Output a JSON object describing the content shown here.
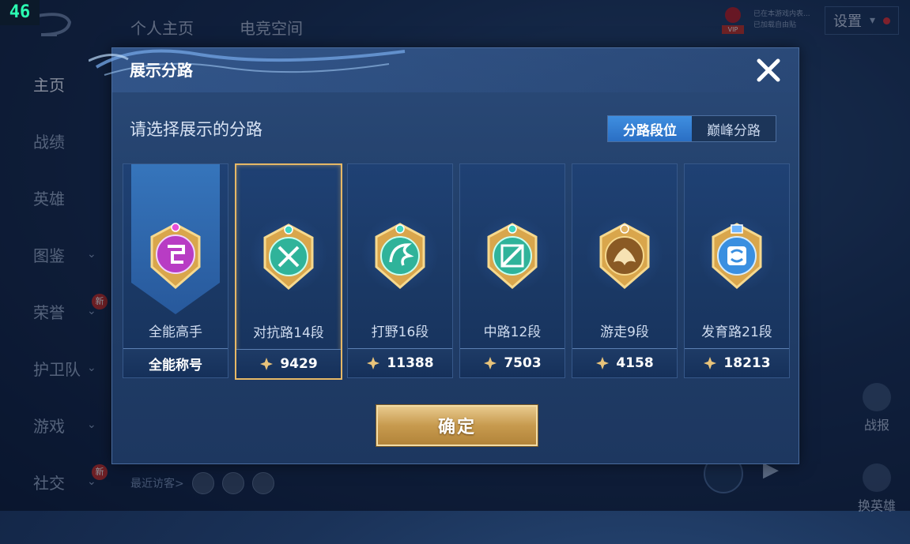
{
  "fps_counter": "46",
  "top_tabs": [
    "个人主页",
    "电竞空间"
  ],
  "top_right": {
    "vip_label": "VIP",
    "notice_line1": "已在本游戏内表...",
    "notice_line2": "已加载自由贴",
    "settings_label": "设置"
  },
  "sidebar": {
    "items": [
      {
        "label": "主页"
      },
      {
        "label": "战绩"
      },
      {
        "label": "英雄"
      },
      {
        "label": "图鉴"
      },
      {
        "label": "荣誉",
        "badge": "新"
      },
      {
        "label": "护卫队"
      },
      {
        "label": "游戏"
      },
      {
        "label": "社交",
        "badge": "新"
      }
    ]
  },
  "visitors_label": "最近访客>",
  "right_widgets": [
    {
      "label": "战报"
    },
    {
      "label": "换英雄"
    }
  ],
  "dialog": {
    "title": "展示分路",
    "subtitle": "请选择展示的分路",
    "tabs": [
      "分路段位",
      "巅峰分路"
    ],
    "active_tab": "分路段位",
    "cards": [
      {
        "category": "全能高手",
        "footer": "全能称号",
        "icon": "all-round-emblem",
        "color": "#b83cc4"
      },
      {
        "category": "对抗路14段",
        "score": "9429",
        "icon": "clash-lane-emblem",
        "color": "#2fb39a",
        "selected": true
      },
      {
        "category": "打野16段",
        "score": "11388",
        "icon": "jungle-emblem",
        "color": "#2fb39a"
      },
      {
        "category": "中路12段",
        "score": "7503",
        "icon": "mid-lane-emblem",
        "color": "#2fb39a"
      },
      {
        "category": "游走9段",
        "score": "4158",
        "icon": "roam-emblem",
        "color": "#c99a4a"
      },
      {
        "category": "发育路21段",
        "score": "18213",
        "icon": "farm-lane-emblem",
        "color": "#3a8fe0"
      }
    ],
    "confirm_label": "确定"
  }
}
